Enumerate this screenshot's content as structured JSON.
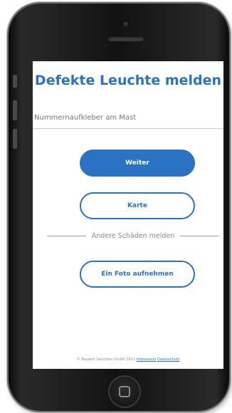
{
  "app": {
    "title": "Defekte Leuchte melden"
  },
  "form": {
    "sticker_placeholder": "Nummernaufkleber am Mast",
    "sticker_value": ""
  },
  "buttons": {
    "continue_label": "Weiter",
    "map_label": "Karte",
    "photo_label": "Ein Foto aufnehmen"
  },
  "divider": {
    "label": "Andere Schäden melden"
  },
  "footer": {
    "copyright": "© Bauamt Leuchten GmbH 2022",
    "imprint_link": "Impressum",
    "privacy_link": "Datenschutz"
  },
  "colors": {
    "accent": "#2b73c2",
    "device_frame": "#121212"
  },
  "icons": {
    "home": "home-button-icon",
    "camera": "front-camera-icon",
    "speaker": "speaker-grille-icon"
  }
}
